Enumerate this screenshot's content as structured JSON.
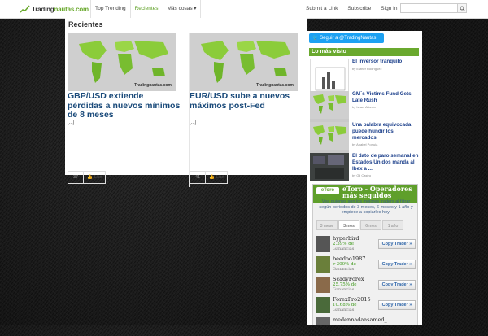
{
  "brand": {
    "logo_prefix": "Trading",
    "logo_suffix": "nautas.com",
    "thumb_brand": "Tradingnautas.com"
  },
  "nav": {
    "items": [
      {
        "label": "Top Trending"
      },
      {
        "label": "Recientes"
      },
      {
        "label": "Más cosas",
        "caret": "▾"
      }
    ],
    "right": [
      "Submit a Link",
      "Subscribe",
      "Sign In"
    ],
    "search_placeholder": ""
  },
  "main": {
    "title": "Recientes",
    "posts": [
      {
        "title": "GBP/USD extiende pérdidas a nuevos mínimos de 8 meses",
        "excerpt": "[...]",
        "count": "37",
        "like": "Like"
      },
      {
        "title": "EUR/USD sube a nuevos máximos post-Fed",
        "excerpt": "[...]",
        "count": "41",
        "like": "Like"
      }
    ]
  },
  "sidebar": {
    "twitter": "Seguir a @TradingNautas",
    "section_title": "Lo más visto",
    "popular": [
      {
        "title": "El inversor tranquilo",
        "author": "by Esther Rodríguez"
      },
      {
        "title": "GM´s Victims Fund Gets Late Rush",
        "author": "by Israel Alberto"
      },
      {
        "title": "Una palabra equivocada puede hundir los mercados",
        "author": "by Anabel Portuja"
      },
      {
        "title": "El dato de paro semanal en Estados Unidos manda al Ibex a ...",
        "author": "by Gil Castro"
      }
    ]
  },
  "etoro": {
    "logo": "eToro",
    "title": "eToro - Operadores más seguidos",
    "description": "Vea quienes son los mejores traders al filtrar según periodos de 3 meses, 6 meses y 1 año y empiece a copiarles hoy!",
    "tabs": [
      "3 mese",
      "3 mes",
      "6 mes",
      "1 año"
    ],
    "active_tab": 1,
    "copy_label": "Copy Trader »",
    "traders": [
      {
        "name": "hyperbird",
        "gain": "2.39% de",
        "period": "Ganancias"
      },
      {
        "name": "beedoo1987",
        "gain": ">300% de",
        "period": "Ganancias"
      },
      {
        "name": "ScadyForex",
        "gain": "25.75% de",
        "period": "Ganancias"
      },
      {
        "name": "ForexPro2015",
        "gain": "10.68% de",
        "period": "Ganancias"
      },
      {
        "name": "medennadaasamed_",
        "gain": "",
        "period": ""
      }
    ]
  },
  "colors": {
    "accent": "#6aa92e",
    "link": "#1a4a7a",
    "twitter": "#1da1f2",
    "etoro": "#5f9f2b"
  }
}
